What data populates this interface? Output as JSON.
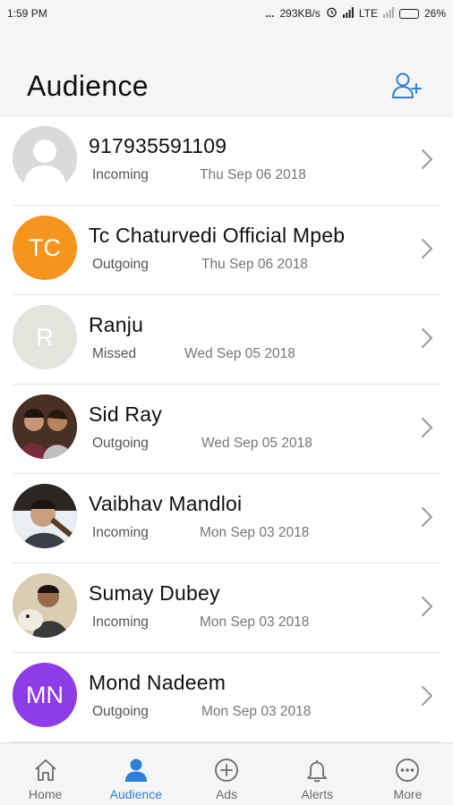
{
  "status_bar": {
    "time": "1:59 PM",
    "network_speed": "293KB/s",
    "lte": "LTE",
    "battery": "26%",
    "battery_level": 0.26
  },
  "header": {
    "title": "Audience"
  },
  "contacts": [
    {
      "name": "917935591109",
      "type": "Incoming",
      "date": "Thu Sep 06 2018",
      "avatar": {
        "kind": "placeholder",
        "initials": "",
        "color": "#d9dadc"
      }
    },
    {
      "name": "Tc Chaturvedi Official Mpeb",
      "type": "Outgoing",
      "date": "Thu Sep 06 2018",
      "avatar": {
        "kind": "initials",
        "initials": "TC",
        "color": "#f7941d"
      }
    },
    {
      "name": "Ranju",
      "type": "Missed",
      "date": "Wed Sep 05 2018",
      "avatar": {
        "kind": "initials",
        "initials": "R",
        "color": "#e4e4dc"
      }
    },
    {
      "name": "Sid Ray",
      "type": "Outgoing",
      "date": "Wed Sep 05 2018",
      "avatar": {
        "kind": "photo",
        "initials": "",
        "color": "#5a3b2e"
      }
    },
    {
      "name": "Vaibhav Mandloi",
      "type": "Incoming",
      "date": "Mon Sep 03 2018",
      "avatar": {
        "kind": "photo",
        "initials": "",
        "color": "#3c3330"
      }
    },
    {
      "name": "Sumay Dubey",
      "type": "Incoming",
      "date": "Mon Sep 03 2018",
      "avatar": {
        "kind": "photo",
        "initials": "",
        "color": "#b8a88a"
      }
    },
    {
      "name": "Mond Nadeem",
      "type": "Outgoing",
      "date": "Mon Sep 03 2018",
      "avatar": {
        "kind": "initials",
        "initials": "MN",
        "color": "#8e3be8"
      }
    }
  ],
  "tabs": [
    {
      "label": "Home",
      "icon": "home-icon",
      "active": false
    },
    {
      "label": "Audience",
      "icon": "person-icon",
      "active": true
    },
    {
      "label": "Ads",
      "icon": "plus-circle-icon",
      "active": false
    },
    {
      "label": "Alerts",
      "icon": "bell-icon",
      "active": false
    },
    {
      "label": "More",
      "icon": "more-icon",
      "active": false
    }
  ],
  "colors": {
    "accent": "#2f7fd8",
    "inactive_tab": "#6b6b6b"
  }
}
